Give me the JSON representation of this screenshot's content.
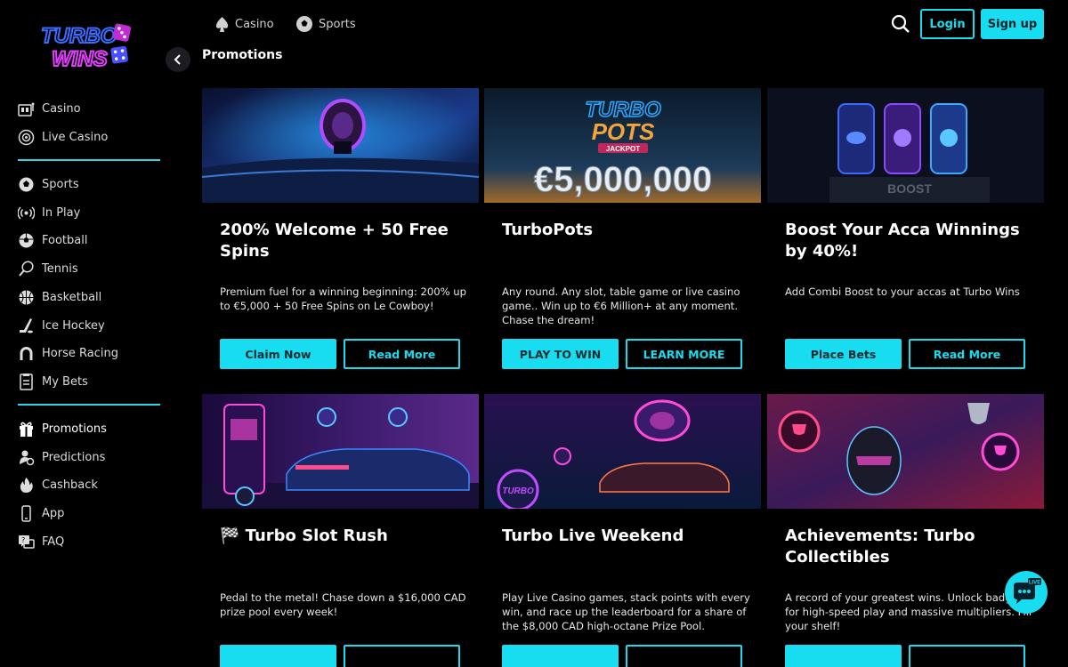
{
  "brand": {
    "logo_line1": "TURBO",
    "logo_line2": "WINS"
  },
  "topnav": {
    "casino": "Casino",
    "sports": "Sports",
    "login": "Login",
    "signup": "Sign up"
  },
  "page_title": "Promotions",
  "sidebar": {
    "group1": [
      {
        "label": "Casino",
        "icon": "slot-machine-icon"
      },
      {
        "label": "Live Casino",
        "icon": "roulette-icon"
      }
    ],
    "group2": [
      {
        "label": "Sports",
        "icon": "ball-icon"
      },
      {
        "label": "In Play",
        "icon": "broadcast-icon"
      },
      {
        "label": "Football",
        "icon": "football-icon"
      },
      {
        "label": "Tennis",
        "icon": "tennis-icon"
      },
      {
        "label": "Basketball",
        "icon": "basketball-icon"
      },
      {
        "label": "Ice Hockey",
        "icon": "hockey-stick-icon"
      },
      {
        "label": "Horse Racing",
        "icon": "horseshoe-icon"
      },
      {
        "label": "My Bets",
        "icon": "betslip-icon"
      }
    ],
    "group3": [
      {
        "label": "Promotions",
        "icon": "gift-icon"
      },
      {
        "label": "Predictions",
        "icon": "predictions-icon"
      },
      {
        "label": "Cashback",
        "icon": "fire-icon"
      },
      {
        "label": "App",
        "icon": "phone-icon"
      },
      {
        "label": "FAQ",
        "icon": "faq-icon"
      }
    ]
  },
  "cards": [
    {
      "title": "200% Welcome + 50 Free Spins",
      "desc": "Premium fuel for a winning beginning: 200% up to €5,000 + 50 Free Spins on Le Cowboy!",
      "btn1": "Claim Now",
      "btn2": "Read More"
    },
    {
      "title": "TurboPots",
      "desc": "Any round. Any slot, table game or live casino game.. Win up to €6 Million+ at any moment. Chase the dream!",
      "btn1": "PLAY TO WIN",
      "btn2": "LEARN MORE",
      "banner_line1": "TURBO",
      "banner_line2": "POTS",
      "banner_tag": "JACKPOT",
      "banner_amount": "€5,000,000"
    },
    {
      "title": "Boost Your Acca Winnings by 40%!",
      "desc": "Add Combi Boost to your accas at Turbo Wins",
      "btn1": "Place Bets",
      "btn2": "Read More",
      "banner_word": "BOOST"
    },
    {
      "title": "🏁 Turbo Slot Rush",
      "desc": "Pedal to the metal! Chase down a $16,000 CAD prize pool every week!"
    },
    {
      "title": "Turbo Live Weekend",
      "desc": "Play Live Casino games, stack points with every win, and race up the leaderboard for a share of the $8,000 CAD high-octane Prize Pool.",
      "banner_chip": "TURBO"
    },
    {
      "title": "Achievements: Turbo Collectibles",
      "desc": "A record of your greatest wins. Unlock badges for high-speed play and massive multipliers. Fill your shelf!"
    }
  ],
  "chat": {
    "badge": "LIVE"
  },
  "colors": {
    "accent": "#18dcef",
    "logo_pink": "#e040fb",
    "background": "#000000"
  }
}
